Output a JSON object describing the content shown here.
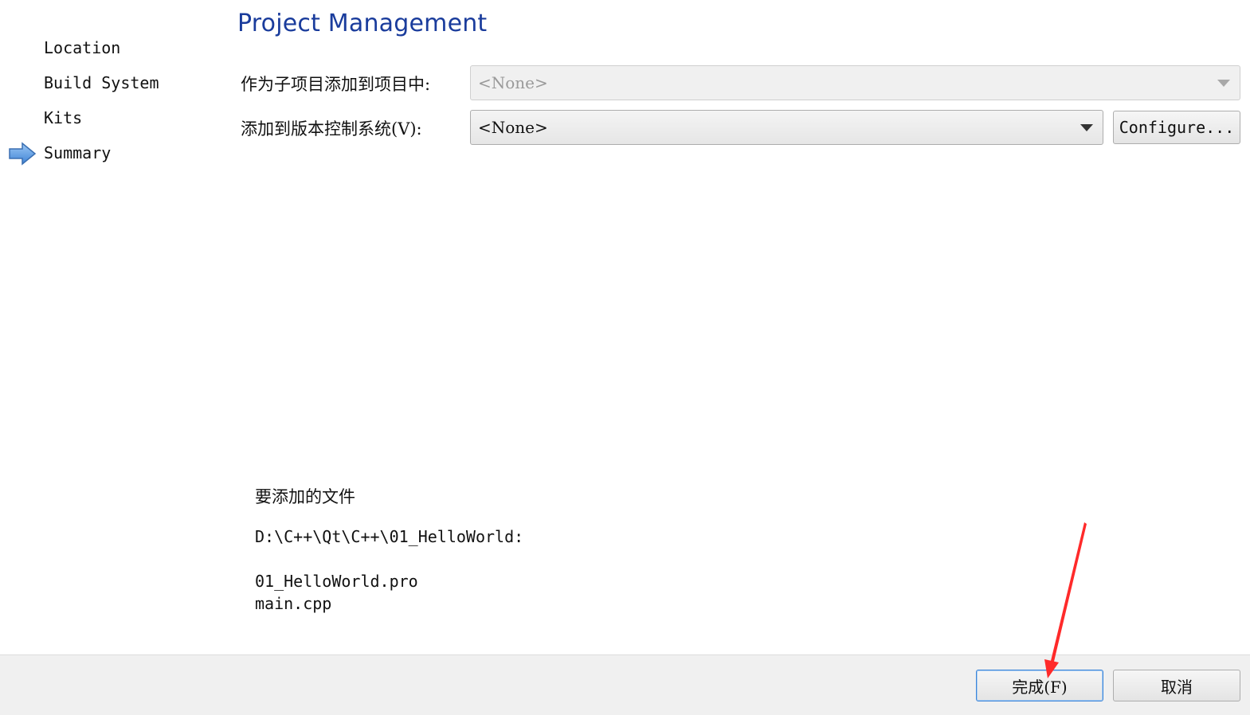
{
  "sidebar": {
    "steps": [
      {
        "label": "Location"
      },
      {
        "label": "Build System"
      },
      {
        "label": "Kits"
      },
      {
        "label": "Summary",
        "current": true
      }
    ]
  },
  "page": {
    "title": "Project Management"
  },
  "form": {
    "subproject_label": "作为子项目添加到项目中:",
    "subproject_value": "<None>",
    "vcs_label": "添加到版本控制系统(V):",
    "vcs_value": "<None>",
    "configure_button": "Configure..."
  },
  "files": {
    "heading": "要添加的文件",
    "directory": "D:\\C++\\Qt\\C++\\01_HelloWorld:",
    "list": [
      "01_HelloWorld.pro",
      "main.cpp"
    ]
  },
  "footer": {
    "finish_button": "完成(F)",
    "cancel_button": "取消"
  },
  "colors": {
    "title": "#1a3c9c",
    "arrow": "#4a8fe0",
    "annotation_arrow": "#ff2a2a",
    "default_button_border": "#3b84d8"
  },
  "icons": {
    "current_step": "right-arrow-icon",
    "dropdown": "chevron-down-icon"
  }
}
